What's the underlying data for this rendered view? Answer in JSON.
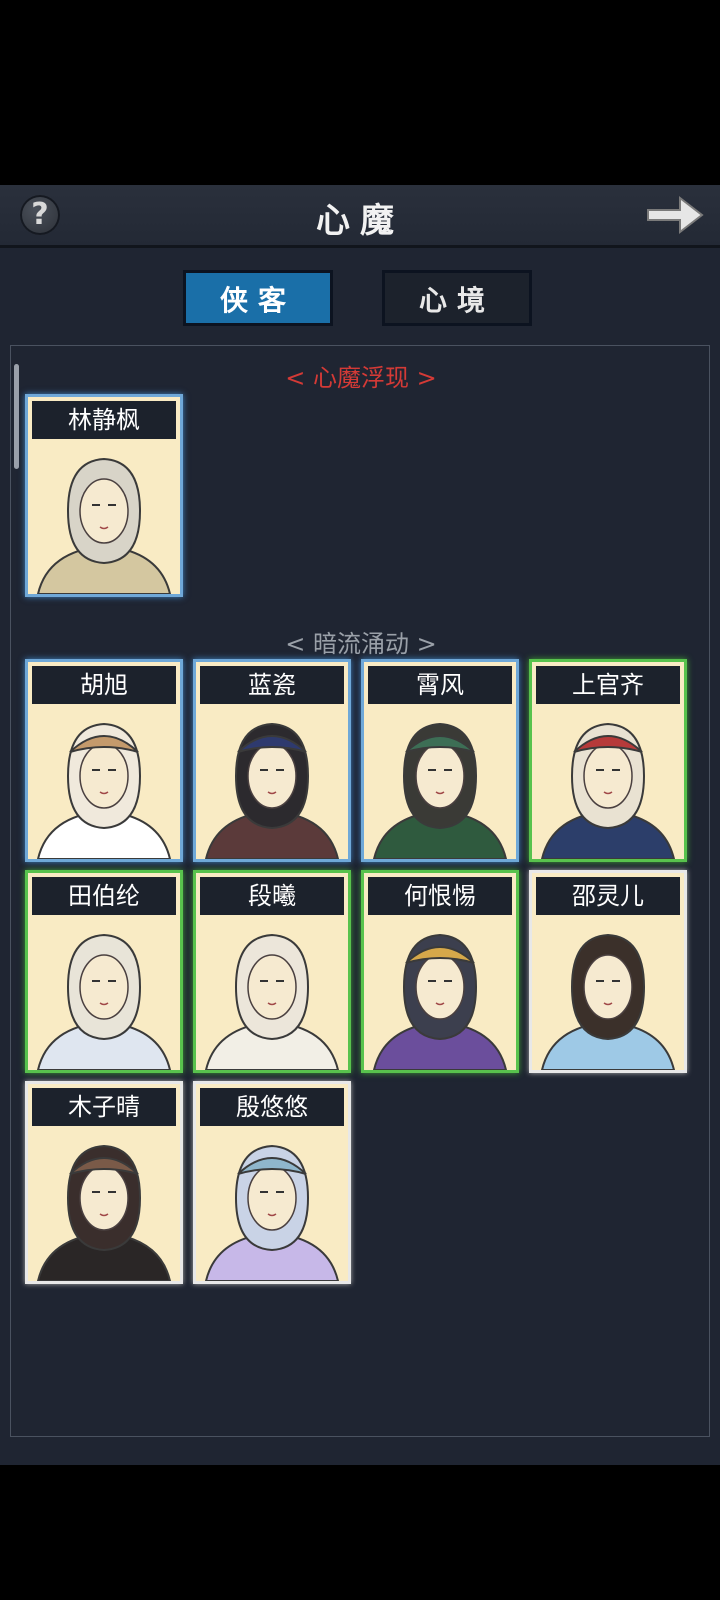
{
  "header": {
    "help_icon_glyph": "?",
    "title": "心魔",
    "back_icon": "arrow-right-icon"
  },
  "tabs": [
    {
      "label": "侠客",
      "active": true
    },
    {
      "label": "心境",
      "active": false
    }
  ],
  "sections": [
    {
      "title": "< 心魔浮现 >",
      "color": "#d43a36"
    },
    {
      "title": "< 暗流涌动 >",
      "color": "#9aa0a8"
    }
  ],
  "cards": [
    {
      "name": "林静枫",
      "rarity": "blue"
    },
    {
      "name": "胡旭",
      "rarity": "blue"
    },
    {
      "name": "蓝瓷",
      "rarity": "blue"
    },
    {
      "name": "霄风",
      "rarity": "blue"
    },
    {
      "name": "上官齐",
      "rarity": "green"
    },
    {
      "name": "田伯纶",
      "rarity": "green"
    },
    {
      "name": "段曦",
      "rarity": "green"
    },
    {
      "name": "何恨惕",
      "rarity": "green"
    },
    {
      "name": "邵灵儿",
      "rarity": "white"
    },
    {
      "name": "木子晴",
      "rarity": "white"
    },
    {
      "name": "殷悠悠",
      "rarity": "white"
    }
  ],
  "colors": {
    "panel_bg": "#1f2532",
    "tab_active": "#1a6fa8",
    "rarity_blue": "#6fa8d8",
    "rarity_green": "#58c24d",
    "rarity_white": "#e8e8e8",
    "card_bg": "#f9ebc4"
  }
}
